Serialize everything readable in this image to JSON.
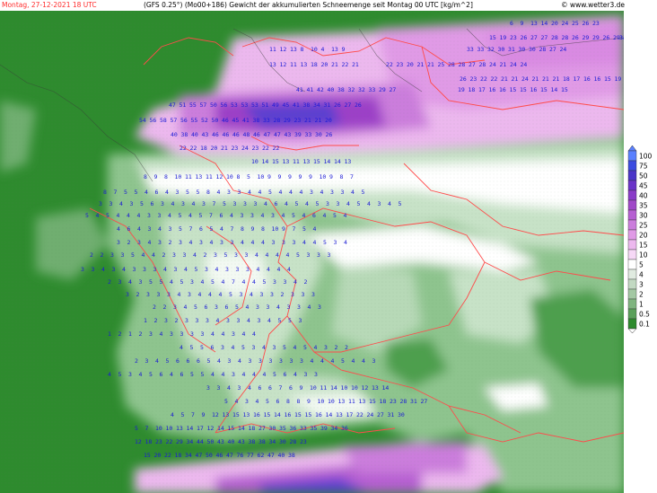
{
  "header": {
    "date": "Montag, 27-12-2021  18 UTC",
    "model": "(GFS 0.25°) (Mo00+186)  Gewicht der akkumulierten Schneemenge seit Montag 00 UTC [kg/m^2]",
    "site": "© www.wetter3.de"
  },
  "colors": {
    "bg_green": "#2e8b2e",
    "green_mid": "#4e9f4e",
    "green_light": "#8ec48e",
    "green_pale": "#c7e2c7",
    "white": "#ffffff",
    "pink_light": "#f1c6f1",
    "pink": "#e89be8",
    "violet": "#cf6ad8",
    "purple": "#9c3fc7",
    "indigo": "#5b3fd0",
    "blue": "#3f4fe0",
    "border": "#ff4b4b",
    "numbers": "#1b1bd6"
  },
  "legend": {
    "labels": [
      "100",
      "75",
      "50",
      "45",
      "40",
      "35",
      "30",
      "25",
      "20",
      "15",
      "10",
      "5",
      "4",
      "3",
      "2",
      "1",
      "0.5",
      "0.1"
    ],
    "swatches": [
      "#5a80ff",
      "#3b4be0",
      "#4a35c8",
      "#6a34c8",
      "#8a3cc8",
      "#a048c8",
      "#b65fd2",
      "#cb7ddc",
      "#e09ae6",
      "#ecb8ee",
      "#f6d8f6",
      "#ffffff",
      "#e0ebe0",
      "#c2d9c2",
      "#a3c8a3",
      "#7fb47f",
      "#5aa05a",
      "#2e8b2e"
    ]
  },
  "map": {
    "rows": [
      "6 9 13 14 20 24 25 26 23",
      "15 19 23 26 27 27 28 28 26 29 29 26 29 32 34",
      "11 12 13 8 10 4 13 9",
      "33 33 32 30 31 30 30 28 27 24",
      "22 23 20 21 21 25 28 28 27 28 24 21 24 24",
      "13 12 11 13 18 20 21 22 21",
      "26 23 22 22 21 21 24 21 21 21 18 17 16 16 15 19",
      "41 41 42 40 38 32 32 33 29 27",
      "19 18 17 16 16 15 15 16 15 14 15",
      "47 51 55 57 50 56 53 53 53 51 49 45 41 38 34 31 26 27 26",
      "54 56 58 57 56 55 52 50 46 45 41 38 33 28 29 23 21 21 20",
      "40 38 40 43 46 46 46 48 46 47 47 43 39 33 30 26",
      "22 22 18 20 21 23 24 23 22 22",
      "10 14 15 13 11 13 15 14 14 13",
      "8 9 8 10 11 13 11 12 10 8 5 10 9 9 9 9 9 10 9 8 7",
      "8 7 5 5 4 6 4 3 5 5 8 4 3 3 4 4 5 4 4 4 3 4 3 3 4 5",
      "3 3 4 3 5 6 3 4 3 4 3 7 5 3 3 3 4 6 4 5 4 5 3 3 4 5 4 3 4 5",
      "5 4 5 4 4 4 3 3 4 5 4 5 7 6 4 3 3 4 3 4 5 4 6 4 5 4",
      "4 6 4 3 4 3 5 7 6 5 4 7 8 9 8 10 9 7 5 4",
      "3 2 3 4 3 2 3 4 3 4 3 3 4 4 4 3 3 3 4 4 5 3 4",
      "2 2 3 3 5 4 4 2 3 3 4 2 3 5 3 3 4 4 4 4 5 3 3 3",
      "3 3 4 3 4 3 3 3 4 3 4 5 3 4 3 3 3 4 4 4 4",
      "2 3 4 3 5 5 4 5 3 4 5 4 7 4 4 5 3 3 4 2",
      "3 2 3 3 3 4 3 4 4 4 5 3 4 3 3 2 3 3 3",
      "2 2 3 4 5 6 3 6 5 4 3 3 4 3 3 4 3",
      "1 2 3 2 3 3 3 4 3 3 4 3 4 5 5 3",
      "1 2 1 2 3 4 3 3 3 3 4 4 3 4 4",
      "4 5 5 6 3 4 5 3 4 3 5 4 5 4 3 2 2",
      "2 3 4 5 6 6 6 5 4 3 4 3 3 3 3 3 3 4 4 4 5 4 4 3",
      "4 5 3 4 5 6 4 6 5 5 4 4 3 4 4 4 5 6 4 3 3",
      "3 3 4 3 4 6 6 7 6 9 10 11 14 10 10 12 13 14",
      "5 4 3 4 5 6 8 8 9 10 10 13 11 13 15 18 23 28 31 27",
      "4 5 7 9 12 13 15 13 16 15 14 16 15 15 16 14 13 17 22 24 27 31 30",
      "5 7 10 10 13 14 17 12 14 15 14 18 27 30 35 36 33 35 39 34 36",
      "12 18 23 22 29 34 44 50 43 40 43 38 38 34 30 28 23",
      "15 20 22 18 34 47 50 46 47 76 77 62 47 40 38"
    ]
  }
}
